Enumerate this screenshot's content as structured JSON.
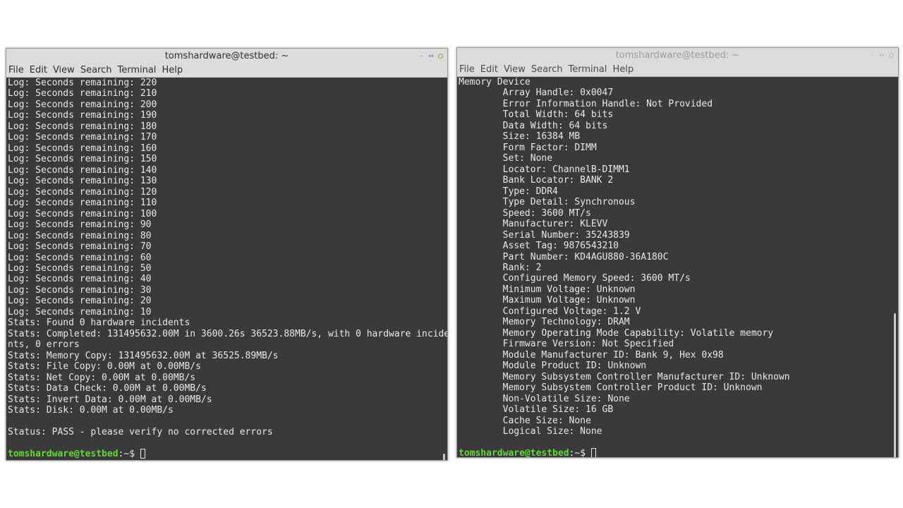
{
  "left": {
    "title": "tomshardware@testbed: ~",
    "menu": [
      "File",
      "Edit",
      "View",
      "Search",
      "Terminal",
      "Help"
    ],
    "lines": [
      "Log: Seconds remaining: 220",
      "Log: Seconds remaining: 210",
      "Log: Seconds remaining: 200",
      "Log: Seconds remaining: 190",
      "Log: Seconds remaining: 180",
      "Log: Seconds remaining: 170",
      "Log: Seconds remaining: 160",
      "Log: Seconds remaining: 150",
      "Log: Seconds remaining: 140",
      "Log: Seconds remaining: 130",
      "Log: Seconds remaining: 120",
      "Log: Seconds remaining: 110",
      "Log: Seconds remaining: 100",
      "Log: Seconds remaining: 90",
      "Log: Seconds remaining: 80",
      "Log: Seconds remaining: 70",
      "Log: Seconds remaining: 60",
      "Log: Seconds remaining: 50",
      "Log: Seconds remaining: 40",
      "Log: Seconds remaining: 30",
      "Log: Seconds remaining: 20",
      "Log: Seconds remaining: 10",
      "Stats: Found 0 hardware incidents",
      "Stats: Completed: 131495632.00M in 3600.26s 36523.88MB/s, with 0 hardware incide",
      "nts, 0 errors",
      "Stats: Memory Copy: 131495632.00M at 36525.89MB/s",
      "Stats: File Copy: 0.00M at 0.00MB/s",
      "Stats: Net Copy: 0.00M at 0.00MB/s",
      "Stats: Data Check: 0.00M at 0.00MB/s",
      "Stats: Invert Data: 0.00M at 0.00MB/s",
      "Stats: Disk: 0.00M at 0.00MB/s",
      "",
      "Status: PASS - please verify no corrected errors",
      ""
    ],
    "prompt_user": "tomshardware@testbed",
    "prompt_path": ":~$ "
  },
  "right": {
    "title": "tomshardware@testbed: ~",
    "menu": [
      "File",
      "Edit",
      "View",
      "Search",
      "Terminal",
      "Help"
    ],
    "lines": [
      "Memory Device",
      "        Array Handle: 0x0047",
      "        Error Information Handle: Not Provided",
      "        Total Width: 64 bits",
      "        Data Width: 64 bits",
      "        Size: 16384 MB",
      "        Form Factor: DIMM",
      "        Set: None",
      "        Locator: ChannelB-DIMM1",
      "        Bank Locator: BANK 2",
      "        Type: DDR4",
      "        Type Detail: Synchronous",
      "        Speed: 3600 MT/s",
      "        Manufacturer: KLEVV",
      "        Serial Number: 35243839",
      "        Asset Tag: 9876543210",
      "        Part Number: KD4AGU880-36A180C",
      "        Rank: 2",
      "        Configured Memory Speed: 3600 MT/s",
      "        Minimum Voltage: Unknown",
      "        Maximum Voltage: Unknown",
      "        Configured Voltage: 1.2 V",
      "        Memory Technology: DRAM",
      "        Memory Operating Mode Capability: Volatile memory",
      "        Firmware Version: Not Specified",
      "        Module Manufacturer ID: Bank 9, Hex 0x98",
      "        Module Product ID: Unknown",
      "        Memory Subsystem Controller Manufacturer ID: Unknown",
      "        Memory Subsystem Controller Product ID: Unknown",
      "        Non-Volatile Size: None",
      "        Volatile Size: 16 GB",
      "        Cache Size: None",
      "        Logical Size: None",
      ""
    ],
    "prompt_user": "tomshardware@testbed",
    "prompt_path": ":~$ "
  }
}
